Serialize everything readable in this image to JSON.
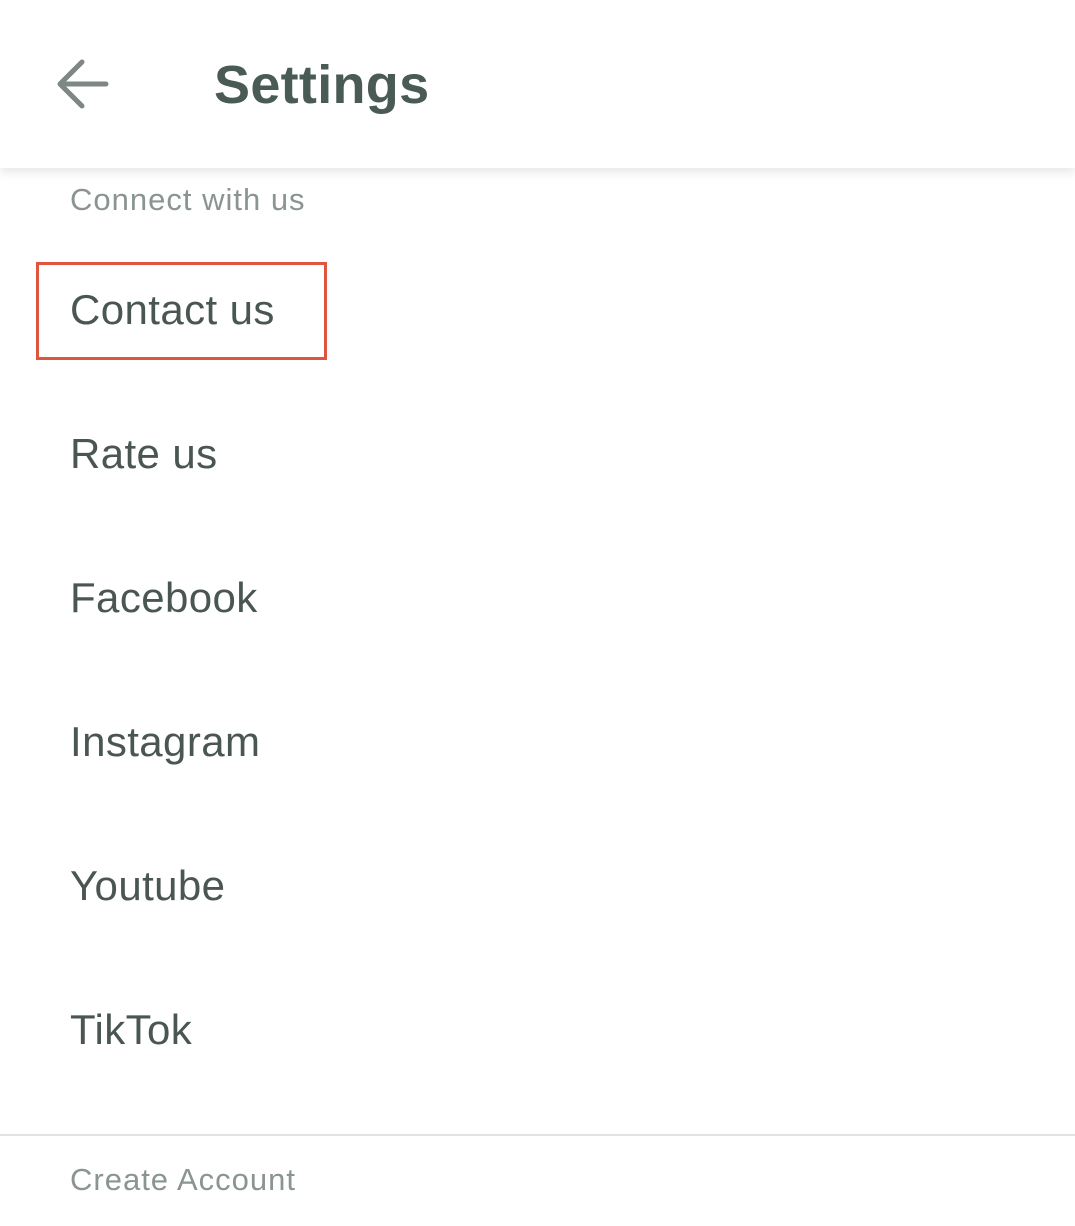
{
  "app_bar": {
    "title": "Settings",
    "back_icon": "arrow-left-icon"
  },
  "connect_section": {
    "header": "Connect with us",
    "items": [
      {
        "label": "Contact us",
        "highlighted": true
      },
      {
        "label": "Rate us"
      },
      {
        "label": "Facebook"
      },
      {
        "label": "Instagram"
      },
      {
        "label": "Youtube"
      },
      {
        "label": "TikTok"
      }
    ]
  },
  "account_section": {
    "header": "Create Account"
  },
  "colors": {
    "title": "#4a5a55",
    "section_header": "#8a9591",
    "item_text": "#4a5652",
    "highlight": "#e0553d",
    "divider": "#dfe3e2"
  }
}
